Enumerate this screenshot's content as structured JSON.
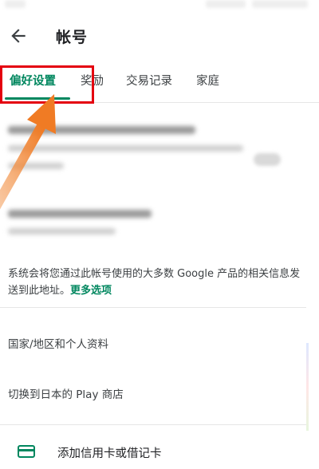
{
  "header": {
    "title": "帐号"
  },
  "tabs": [
    {
      "label": "偏好设置",
      "active": true
    },
    {
      "label": "奖励",
      "active": false
    },
    {
      "label": "交易记录",
      "active": false
    },
    {
      "label": "家庭",
      "active": false
    }
  ],
  "info": {
    "text": "系统会将您通过此帐号使用的大多数 Google 产品的相关信息发送到此地址。",
    "link": "更多选项"
  },
  "list": {
    "country_profile": "国家/地区和个人资料",
    "switch_store": "切换到日本的 Play 商店"
  },
  "payment": {
    "add_card_label": "添加信用卡或借记卡"
  },
  "colors": {
    "accent": "#01875f",
    "highlight": "#e4000f",
    "annotation_arrow": "#f07b24"
  },
  "icons": {
    "back": "arrow-left-icon",
    "card": "credit-card-icon"
  }
}
